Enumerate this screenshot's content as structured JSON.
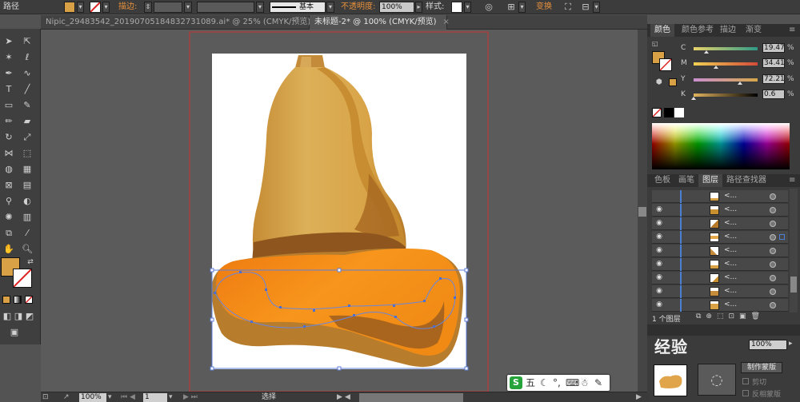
{
  "control_bar": {
    "path_label": "路径",
    "stroke_label": "描边:",
    "stroke_style": "基本",
    "opacity_label": "不透明度:",
    "opacity_value": "100%",
    "style_label": "样式:",
    "transform_label": "变换",
    "fill_color": "#d9a145"
  },
  "doc_tabs": [
    {
      "label": "Nipic_29483542_20190705184832731089.ai* @ 25% (CMYK/预览)",
      "close": "×"
    },
    {
      "label": "未标题-2* @ 100% (CMYK/预览)",
      "close": "×"
    }
  ],
  "color_panel": {
    "tabs": [
      "颜色",
      "颜色参考",
      "描边",
      "渐变"
    ],
    "channels": [
      {
        "label": "C",
        "value": "19.47",
        "percent": 19.47,
        "gradient": "linear-gradient(90deg,#e8d36b,#2f9a86)"
      },
      {
        "label": "M",
        "value": "34.41",
        "percent": 34.41,
        "gradient": "linear-gradient(90deg,#f0d050,#d44a3a)"
      },
      {
        "label": "Y",
        "value": "72.21",
        "percent": 72.21,
        "gradient": "linear-gradient(90deg,#c98fd0,#d6a64a)"
      },
      {
        "label": "K",
        "value": "0.6",
        "percent": 0.6,
        "gradient": "linear-gradient(90deg,#e3b45e,#000000)"
      }
    ],
    "percent_sign": "%"
  },
  "layers_panel": {
    "tabs": [
      "色板",
      "画笔",
      "图层",
      "路径查找器"
    ],
    "rows": [
      {
        "name": "<...",
        "visible": false
      },
      {
        "name": "<...",
        "visible": true
      },
      {
        "name": "<...",
        "visible": true
      },
      {
        "name": "<...",
        "visible": true,
        "selected": true
      },
      {
        "name": "<...",
        "visible": true
      },
      {
        "name": "<...",
        "visible": true
      },
      {
        "name": "<...",
        "visible": true
      },
      {
        "name": "<...",
        "visible": true
      },
      {
        "name": "<...",
        "visible": true
      }
    ],
    "layer_count": "1 个图层"
  },
  "transparency_panel": {
    "opacity": "100%",
    "make_mask_button": "制作蒙版",
    "clip_label": "剪切",
    "invert_mask_label": "反相蒙版"
  },
  "status_bar": {
    "zoom": "100%",
    "page": "1",
    "tool_status": "选择"
  },
  "ime": {
    "mode": "五"
  },
  "watermark": {
    "text": "经验"
  }
}
